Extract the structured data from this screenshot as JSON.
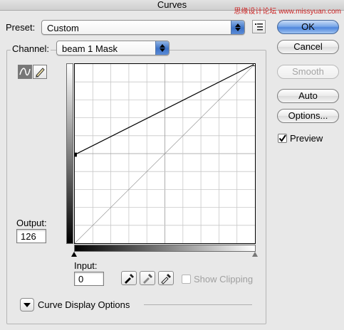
{
  "window": {
    "title": "Curves",
    "watermark": "思缘设计论坛 www.missyuan.com"
  },
  "preset": {
    "label": "Preset:",
    "value": "Custom"
  },
  "channel": {
    "label": "Channel:",
    "value": "beam 1 Mask"
  },
  "buttons": {
    "ok": "OK",
    "cancel": "Cancel",
    "smooth": "Smooth",
    "auto": "Auto",
    "options": "Options..."
  },
  "preview": {
    "label": "Preview",
    "checked": true
  },
  "output": {
    "label": "Output:",
    "value": "126"
  },
  "input": {
    "label": "Input:",
    "value": "0"
  },
  "show_clipping": {
    "label": "Show Clipping",
    "checked": false,
    "enabled": false
  },
  "curve_display_options": {
    "label": "Curve Display Options"
  },
  "curve": {
    "points": [
      [
        0,
        126
      ],
      [
        255,
        255
      ]
    ],
    "grid_divisions": 10
  },
  "icons": {
    "preset_menu": "list-menu-icon",
    "curve_tool": "curve-tool-icon",
    "pencil_tool": "pencil-icon",
    "black_point": "black-eyedropper-icon",
    "gray_point": "gray-eyedropper-icon",
    "white_point": "white-eyedropper-icon",
    "disclosure": "disclosure-triangle-icon"
  }
}
